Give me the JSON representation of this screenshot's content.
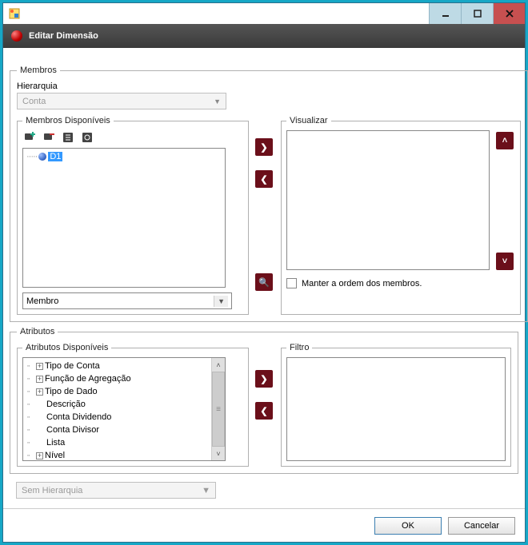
{
  "window": {
    "title": "Editar Dimensão"
  },
  "members_fieldset": {
    "legend": "Membros",
    "hierarchy_label": "Hierarquia",
    "hierarchy_value": "Conta",
    "available_legend": "Membros Disponíveis",
    "tree_item": "D1",
    "combo_value": "Membro",
    "view_legend": "Visualizar",
    "keep_order_label": "Manter a ordem dos membros."
  },
  "attributes_fieldset": {
    "legend": "Atributos",
    "available_legend": "Atributos Disponíveis",
    "items": [
      {
        "label": "Tipo de Conta",
        "expandable": true
      },
      {
        "label": "Função de Agregação",
        "expandable": true
      },
      {
        "label": "Tipo de Dado",
        "expandable": true
      },
      {
        "label": "Descrição",
        "expandable": false
      },
      {
        "label": "Conta Dividendo",
        "expandable": false
      },
      {
        "label": "Conta Divisor",
        "expandable": false
      },
      {
        "label": "Lista",
        "expandable": false
      },
      {
        "label": "Nível",
        "expandable": true
      }
    ],
    "filter_legend": "Filtro"
  },
  "bottom_combo": "Sem Hierarquia",
  "buttons": {
    "ok": "OK",
    "cancel": "Cancelar"
  }
}
